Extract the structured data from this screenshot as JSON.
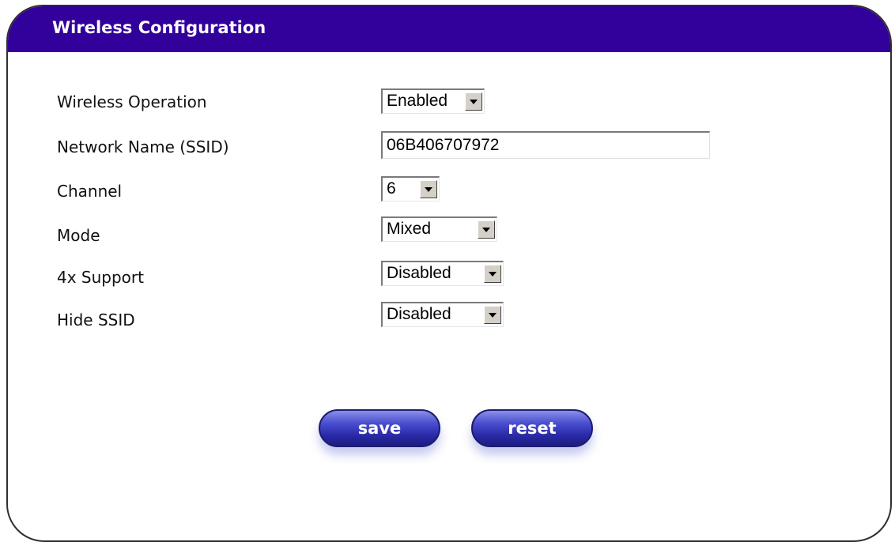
{
  "panel": {
    "title": "Wireless Configuration"
  },
  "fields": {
    "wireless_operation": {
      "label": "Wireless Operation",
      "value": "Enabled"
    },
    "ssid": {
      "label": "Network Name (SSID)",
      "value": "06B406707972"
    },
    "channel": {
      "label": "Channel",
      "value": "6"
    },
    "mode": {
      "label": "Mode",
      "value": "Mixed"
    },
    "support_4x": {
      "label": "4x Support",
      "value": "Disabled"
    },
    "hide_ssid": {
      "label": "Hide SSID",
      "value": "Disabled"
    }
  },
  "actions": {
    "save_label": "save",
    "reset_label": "reset"
  },
  "colors": {
    "title_bar": "#32009a",
    "button": "#2a2aa8"
  }
}
